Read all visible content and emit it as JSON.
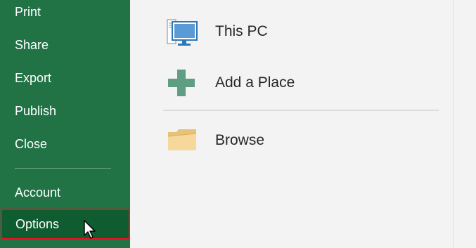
{
  "sidebar": {
    "items": [
      {
        "label": "Print"
      },
      {
        "label": "Share"
      },
      {
        "label": "Export"
      },
      {
        "label": "Publish"
      },
      {
        "label": "Close"
      },
      {
        "label": "Account"
      },
      {
        "label": "Options"
      }
    ],
    "selected": "Options"
  },
  "places": [
    {
      "label": "This PC",
      "icon": "computer-icon"
    },
    {
      "label": "Add a Place",
      "icon": "plus-icon"
    },
    {
      "label": "Browse",
      "icon": "folder-icon"
    }
  ],
  "colors": {
    "sidebar_bg": "#217346",
    "selected_bg": "#0e5c2f",
    "highlight_border": "#e81123",
    "content_bg": "#f3f3f3"
  }
}
